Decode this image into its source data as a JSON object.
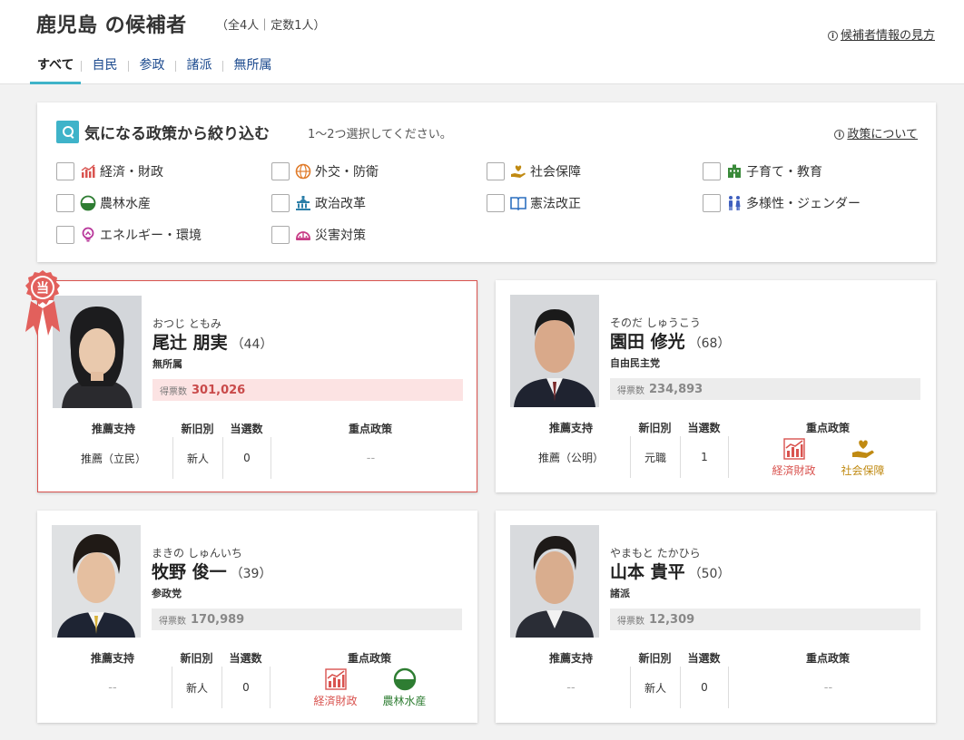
{
  "header": {
    "title": "鹿児島 の候補者",
    "subtitle": "（全4人｜定数1人）",
    "guide_link": "候補者情報の見方",
    "tabs": [
      {
        "label": "すべて",
        "active": true
      },
      {
        "label": "自民"
      },
      {
        "label": "参政"
      },
      {
        "label": "諸派"
      },
      {
        "label": "無所属"
      }
    ]
  },
  "filter": {
    "title": "気になる政策から絞り込む",
    "hint": "1〜2つ選択してください。",
    "policy_link": "政策について",
    "options": [
      {
        "label": "経済・財政",
        "icon": "economy-chart-icon"
      },
      {
        "label": "外交・防衛",
        "icon": "globe-icon"
      },
      {
        "label": "社会保障",
        "icon": "heart-hand-icon"
      },
      {
        "label": "子育て・教育",
        "icon": "school-icon"
      },
      {
        "label": "農林水産",
        "icon": "rice-bowl-icon"
      },
      {
        "label": "政治改革",
        "icon": "parliament-icon"
      },
      {
        "label": "憲法改正",
        "icon": "book-icon"
      },
      {
        "label": "多様性・ジェンダー",
        "icon": "people-icon"
      },
      {
        "label": "エネルギー・環境",
        "icon": "lightbulb-icon"
      },
      {
        "label": "災害対策",
        "icon": "helmet-icon"
      }
    ]
  },
  "labels": {
    "votes": "得票数",
    "support": "推薦支持",
    "status": "新旧別",
    "elected_count": "当選数",
    "key_policy": "重点政策",
    "winner_badge": "当"
  },
  "candidates": [
    {
      "kana": "おつじ ともみ",
      "name": "尾辻 朋実",
      "age": "（44）",
      "party": "無所属",
      "votes": "301,026",
      "support": "推薦（立民）",
      "status": "新人",
      "elected": "0",
      "policies": [],
      "policy_empty": "--",
      "winner": true
    },
    {
      "kana": "そのだ しゅうこう",
      "name": "園田 修光",
      "age": "（68）",
      "party": "自由民主党",
      "votes": "234,893",
      "support": "推薦（公明）",
      "status": "元職",
      "elected": "1",
      "policies": [
        {
          "label": "経済財政",
          "icon": "economy-chart-icon",
          "color": "#d9534f"
        },
        {
          "label": "社会保障",
          "icon": "heart-hand-icon",
          "color": "#c08a12"
        }
      ]
    },
    {
      "kana": "まきの しゅんいち",
      "name": "牧野 俊一",
      "age": "（39）",
      "party": "参政党",
      "votes": "170,989",
      "support": "--",
      "status": "新人",
      "elected": "0",
      "policies": [
        {
          "label": "経済財政",
          "icon": "economy-chart-icon",
          "color": "#d9534f"
        },
        {
          "label": "農林水産",
          "icon": "rice-bowl-icon",
          "color": "#2e7d32"
        }
      ]
    },
    {
      "kana": "やまもと たかひら",
      "name": "山本 貴平",
      "age": "（50）",
      "party": "諸派",
      "votes": "12,309",
      "support": "--",
      "status": "新人",
      "elected": "0",
      "policies": [],
      "policy_empty": "--"
    }
  ],
  "colors": {
    "accent": "#3fb3c9",
    "tab_link": "#1d4b8f",
    "winner": "#d9534f"
  }
}
